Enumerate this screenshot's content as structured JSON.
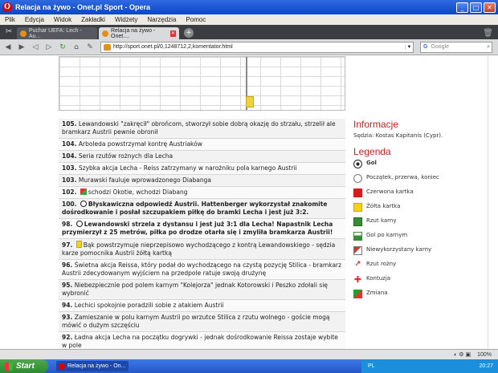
{
  "window": {
    "title": "Relacja na żywo - Onet.pl Sport - Opera",
    "app_icon": "O"
  },
  "menu": [
    "Plik",
    "Edycja",
    "Widok",
    "Zakładki",
    "Widżety",
    "Narzędzia",
    "Pomoc"
  ],
  "tabs": [
    {
      "label": "Puchar UEFA: Lech - Au...",
      "active": false
    },
    {
      "label": "Relacja na żywo - Onet....",
      "active": true
    }
  ],
  "address": {
    "url": "http://sport.onet.pl/0,1248712,2,komentator.html"
  },
  "search": {
    "engine": "G",
    "placeholder": "Google"
  },
  "commentary": [
    {
      "num": "105.",
      "text": "Lewandowski \"zakręcił\" obrońcom, stworzył sobie dobrą okazję do strzału, strzelił ale bramkarz Austrii pewnie obronił",
      "bold": false,
      "icon": ""
    },
    {
      "num": "104.",
      "text": "Arboleda powstrzymał kontrę Austriaków",
      "bold": false,
      "icon": ""
    },
    {
      "num": "104.",
      "text": "Seria rzutów rożnych dla Lecha",
      "bold": false,
      "icon": ""
    },
    {
      "num": "103.",
      "text": "Szybka akcja Lecha - Reiss zatrzymany w narożniku pola karnego Austrii",
      "bold": false,
      "icon": ""
    },
    {
      "num": "103.",
      "text": "Murawski fauluje wprowadzonego Diabanga",
      "bold": false,
      "icon": ""
    },
    {
      "num": "102.",
      "text": "schodzi Okotie, wchodzi Diabang",
      "bold": false,
      "icon": "swap"
    },
    {
      "num": "100.",
      "text": "Błyskawiczna odpowiedź Austrii. Hattenberger wykorzystał znakomite dośrodkowanie i posłał szczupakiem piłkę do bramki Lecha i jest już 3:2.",
      "bold": true,
      "icon": "ball"
    },
    {
      "num": "98.",
      "text": "Lewandowski strzela z dystansu i jest już 3:1 dla Lecha! Napastnik Lecha przymierzył z 25 metrów, piłka po drodze otarła się i zmyliła bramkarza Austrii!",
      "bold": true,
      "icon": "ball"
    },
    {
      "num": "97.",
      "text": "Bąk powstrzymuje nieprzepisowo wychodzącego z kontrą Lewandowskiego - sędzia karze pomocnika Austrii żółtą kartką",
      "bold": false,
      "icon": "yellow"
    },
    {
      "num": "96.",
      "text": "Świetna akcja Reissa, który podał do wychodzącego na czystą pozycję Stilica - bramkarz Austrii zdecydowanym wyjściem na przedpole ratuje swoją drużynę",
      "bold": false,
      "icon": ""
    },
    {
      "num": "95.",
      "text": "Niebezpiecznie pod polem karnym \"Kolejorza\" jednak Kotorowski i Peszko zdołali się wybronić",
      "bold": false,
      "icon": ""
    },
    {
      "num": "94.",
      "text": "Lechici spokojnie poradzili sobie z atakiem Austrii",
      "bold": false,
      "icon": ""
    },
    {
      "num": "93.",
      "text": "Zamieszanie w polu karnym Austrii po wrzutce Stilica z rzutu wolnego - goście mogą mówić o dużym szczęściu",
      "bold": false,
      "icon": ""
    },
    {
      "num": "92.",
      "text": "Ładna akcja Lecha na początku dogrywki - jednak dośrodkowanie Reissa zostaje wybite w pole",
      "bold": false,
      "icon": ""
    }
  ],
  "info": {
    "heading": "Informacje",
    "referee": "Sędzia: Kostas Kapitanis (Cypr)."
  },
  "legend": {
    "heading": "Legenda",
    "items": [
      {
        "icon": "ball",
        "label": "Gol",
        "bold": true
      },
      {
        "icon": "clock",
        "label": "Początek, przerwa, koniec",
        "bold": false
      },
      {
        "icon": "red",
        "label": "Czerwona kartka",
        "bold": false
      },
      {
        "icon": "yel",
        "label": "Żółta kartka",
        "bold": false
      },
      {
        "icon": "goal",
        "label": "Rzut karny",
        "bold": false
      },
      {
        "icon": "penalty",
        "label": "Gol po karnym",
        "bold": false
      },
      {
        "icon": "missed",
        "label": "Niewykorzystany karny",
        "bold": false
      },
      {
        "icon": "foul",
        "label": "Rzut rożny",
        "bold": false
      },
      {
        "icon": "injury",
        "label": "Kontuzja",
        "bold": false
      },
      {
        "icon": "change",
        "label": "Zmiana",
        "bold": false
      }
    ]
  },
  "statusbar": {
    "zoom": "100%"
  },
  "taskbar": {
    "start": "Start",
    "task": "Relacja na żywo - On...",
    "lang": "PL",
    "clock": "20:27"
  }
}
